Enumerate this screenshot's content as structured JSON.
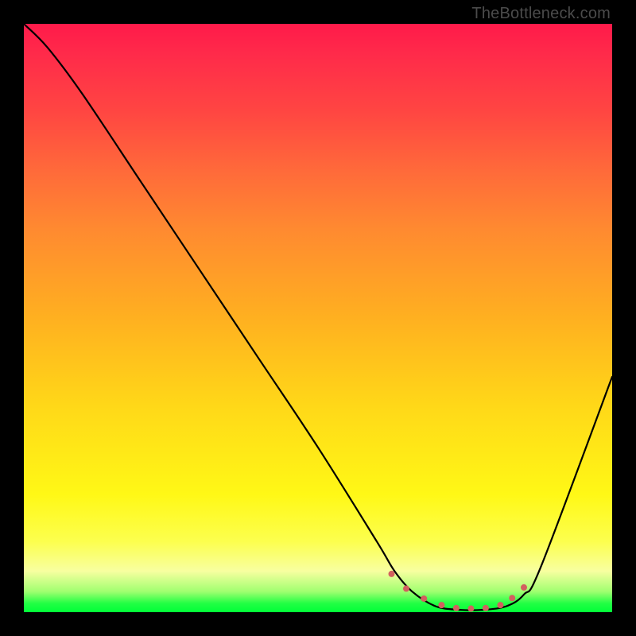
{
  "attribution": "TheBottleneck.com",
  "chart_data": {
    "type": "line",
    "title": "",
    "xlabel": "",
    "ylabel": "",
    "xlim": [
      0,
      100
    ],
    "ylim": [
      0,
      100
    ],
    "series": [
      {
        "name": "curve",
        "color": "#000000",
        "x": [
          0,
          4,
          10,
          20,
          30,
          40,
          50,
          60,
          63,
          66,
          70,
          74,
          78,
          82,
          85,
          88,
          100
        ],
        "y": [
          100,
          96,
          88,
          73,
          58,
          43,
          28,
          12,
          7,
          3.5,
          1,
          0.4,
          0.4,
          1,
          3,
          8,
          40
        ]
      }
    ],
    "markers": {
      "name": "bottom-dots",
      "color": "#d2605f",
      "radius": 4,
      "x": [
        62.5,
        65,
        68,
        71,
        73.5,
        76,
        78.5,
        81,
        83,
        85
      ],
      "y": [
        6.5,
        4,
        2.3,
        1.2,
        0.7,
        0.6,
        0.7,
        1.2,
        2.4,
        4.2
      ]
    }
  }
}
